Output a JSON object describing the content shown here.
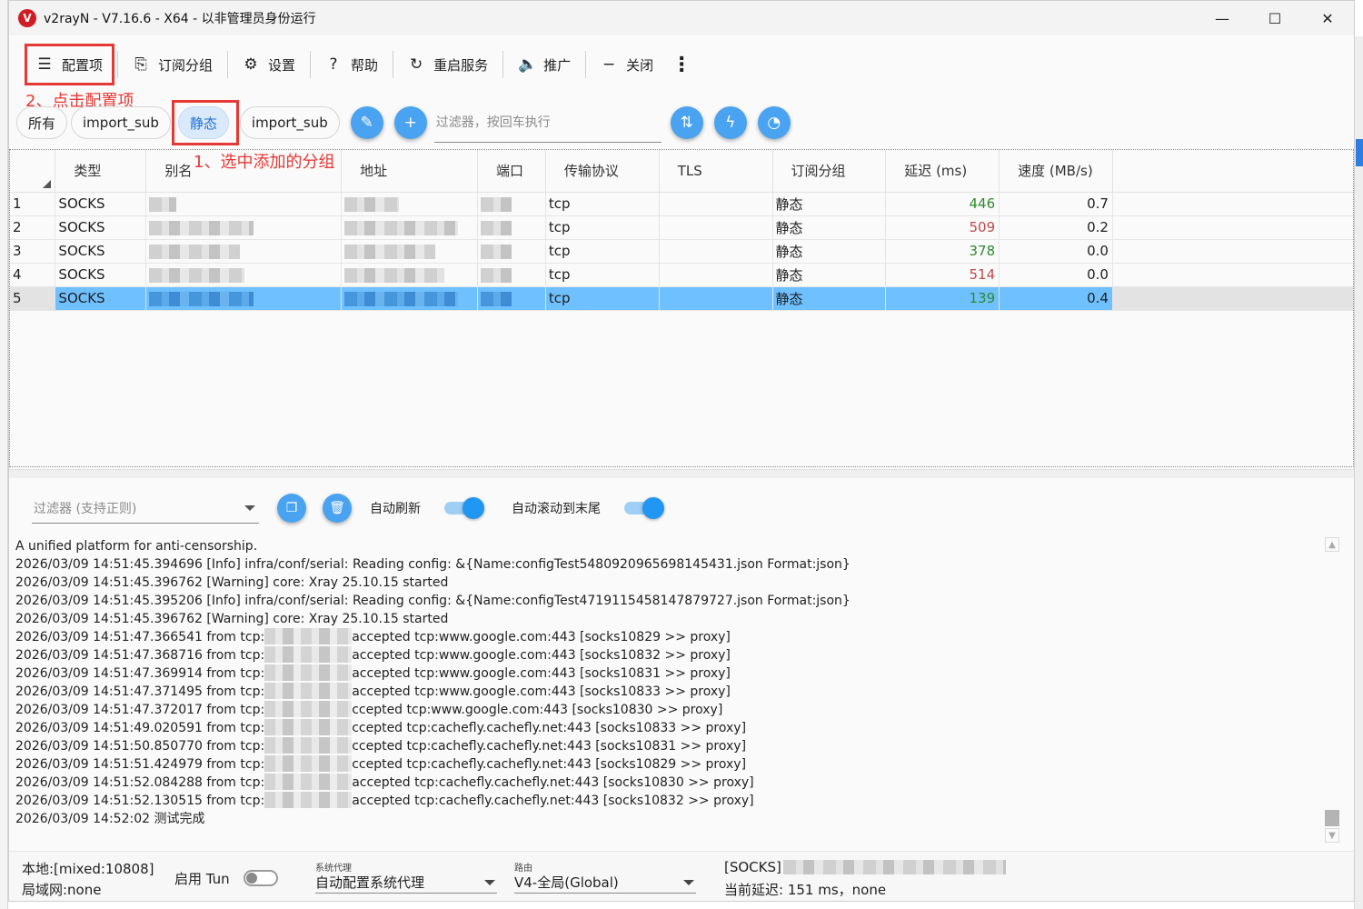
{
  "window": {
    "title": "v2rayN - V7.16.6 - X64 - 以非管理员身份运行",
    "logo_letter": "V",
    "controls": [
      "—",
      "☐",
      "✕"
    ]
  },
  "toolbar": {
    "items": [
      {
        "label": "配置项",
        "icon": "server-list-icon"
      },
      {
        "label": "订阅分组",
        "icon": "subscription-icon"
      },
      {
        "label": "设置",
        "icon": "gear-icon"
      },
      {
        "label": "帮助",
        "icon": "help-icon"
      },
      {
        "label": "重启服务",
        "icon": "restart-icon"
      },
      {
        "label": "推广",
        "icon": "speaker-icon"
      },
      {
        "label": "关闭",
        "icon": "minus-icon"
      }
    ],
    "more_icon": "⋮"
  },
  "annotations": {
    "step2": "2、点击配置项",
    "step1": "1、选中添加的分组"
  },
  "groups": {
    "tabs": [
      "所有",
      "import_sub",
      "静态",
      "import_sub"
    ],
    "active_index": 2,
    "filter_placeholder": "过滤器，按回车执行"
  },
  "server_table": {
    "columns": [
      "类型",
      "别名",
      "地址",
      "端口",
      "传输协议",
      "TLS",
      "订阅分组",
      "延迟 (ms)",
      "速度 (MB/s)"
    ],
    "rows": [
      {
        "index": "1",
        "type": "SOCKS",
        "transport": "tcp",
        "tls": "",
        "group": "静态",
        "delay": "446",
        "speed": "0.7",
        "delay_status": "good"
      },
      {
        "index": "2",
        "type": "SOCKS",
        "transport": "tcp",
        "tls": "",
        "group": "静态",
        "delay": "509",
        "speed": "0.2",
        "delay_status": "bad"
      },
      {
        "index": "3",
        "type": "SOCKS",
        "transport": "tcp",
        "tls": "",
        "group": "静态",
        "delay": "378",
        "speed": "0.0",
        "delay_status": "good"
      },
      {
        "index": "4",
        "type": "SOCKS",
        "transport": "tcp",
        "tls": "",
        "group": "静态",
        "delay": "514",
        "speed": "0.0",
        "delay_status": "bad"
      },
      {
        "index": "5",
        "type": "SOCKS",
        "transport": "tcp",
        "tls": "",
        "group": "静态",
        "delay": "139",
        "speed": "0.4",
        "delay_status": "good"
      }
    ],
    "selected_index": 4,
    "colors": {
      "good": "#2e8b2e",
      "bad": "#c24a4a",
      "selected": "#6fc0ff"
    }
  },
  "log_panel": {
    "filter_placeholder": "过滤器 (支持正则)",
    "auto_refresh_label": "自动刷新",
    "auto_scroll_label": "自动滚动到末尾",
    "auto_refresh_on": true,
    "auto_scroll_on": true,
    "lines": [
      {
        "pre": "A unified platform for anti-censorship.",
        "mask": false,
        "post": ""
      },
      {
        "pre": "2026/03/09 14:51:45.394696 [Info] infra/conf/serial: Reading config: &{Name:configTest5480920965698145431.json Format:json}",
        "mask": false,
        "post": ""
      },
      {
        "pre": "2026/03/09 14:51:45.396762 [Warning] core: Xray 25.10.15 started",
        "mask": false,
        "post": ""
      },
      {
        "pre": "2026/03/09 14:51:45.395206 [Info] infra/conf/serial: Reading config: &{Name:configTest4719115458147879727.json Format:json}",
        "mask": false,
        "post": ""
      },
      {
        "pre": "2026/03/09 14:51:45.396762 [Warning] core: Xray 25.10.15 started",
        "mask": false,
        "post": ""
      },
      {
        "pre": "2026/03/09 14:51:47.366541 from tcp:",
        "mask": true,
        "post": "accepted tcp:www.google.com:443 [socks10829 >> proxy]"
      },
      {
        "pre": "2026/03/09 14:51:47.368716 from tcp:",
        "mask": true,
        "post": "accepted tcp:www.google.com:443 [socks10832 >> proxy]"
      },
      {
        "pre": "2026/03/09 14:51:47.369914 from tcp:",
        "mask": true,
        "post": "accepted tcp:www.google.com:443 [socks10831 >> proxy]"
      },
      {
        "pre": "2026/03/09 14:51:47.371495 from tcp:",
        "mask": true,
        "post": "accepted tcp:www.google.com:443 [socks10833 >> proxy]"
      },
      {
        "pre": "2026/03/09 14:51:47.372017 from tcp:",
        "mask": true,
        "post": "ccepted tcp:www.google.com:443 [socks10830 >> proxy]"
      },
      {
        "pre": "2026/03/09 14:51:49.020591 from tcp:",
        "mask": true,
        "post": "ccepted tcp:cachefly.cachefly.net:443 [socks10833 >> proxy]"
      },
      {
        "pre": "2026/03/09 14:51:50.850770 from tcp:",
        "mask": true,
        "post": "ccepted tcp:cachefly.cachefly.net:443 [socks10831 >> proxy]"
      },
      {
        "pre": "2026/03/09 14:51:51.424979 from tcp:",
        "mask": true,
        "post": "ccepted tcp:cachefly.cachefly.net:443 [socks10829 >> proxy]"
      },
      {
        "pre": "2026/03/09 14:51:52.084288 from tcp:",
        "mask": true,
        "post": "accepted tcp:cachefly.cachefly.net:443 [socks10830 >> proxy]"
      },
      {
        "pre": "2026/03/09 14:51:52.130515 from tcp:",
        "mask": true,
        "post": "accepted tcp:cachefly.cachefly.net:443 [socks10832 >> proxy]"
      },
      {
        "pre": "2026/03/09 14:52:02 测试完成",
        "mask": false,
        "post": ""
      }
    ]
  },
  "statusbar": {
    "local": "本地:[mixed:10808]",
    "lan": "局域网:none",
    "tun_label": "启用 Tun",
    "tun_on": false,
    "sysproxy_caption": "系统代理",
    "sysproxy_value": "自动配置系统代理",
    "routing_caption": "路由",
    "routing_value": "V4-全局(Global)",
    "server_prefix": "[SOCKS]",
    "current_delay": "当前延迟: 151 ms，none"
  }
}
